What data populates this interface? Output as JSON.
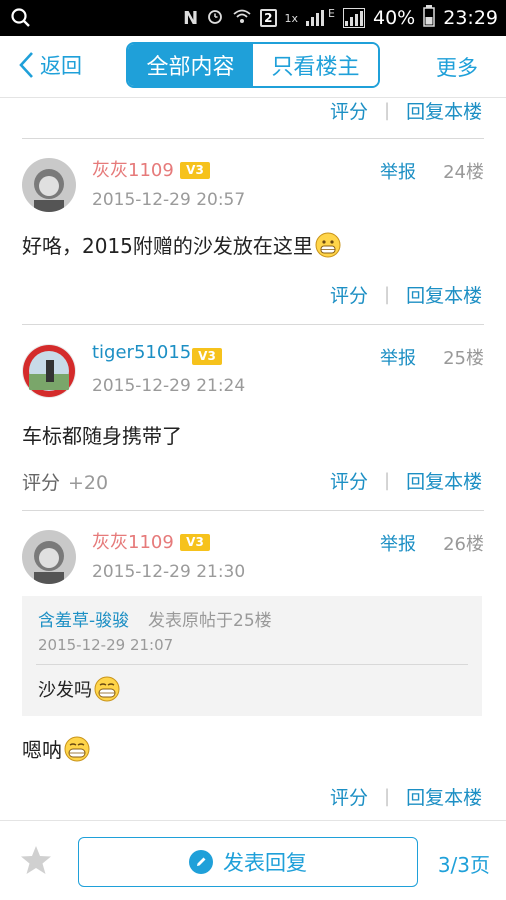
{
  "status_bar": {
    "battery": "40%",
    "time": "23:29",
    "network": "E",
    "net_speed": "1x",
    "notif_count": "2"
  },
  "nav": {
    "back_label": "返回",
    "tab_all": "全部内容",
    "tab_op": "只看楼主",
    "more_label": "更多"
  },
  "actions": {
    "rate": "评分",
    "reply": "回复本楼",
    "separator": "|"
  },
  "posts": [
    {
      "username": "灰灰1109",
      "level": "V3",
      "report": "举报",
      "floor": "24楼",
      "date": "2015-12-29 20:57",
      "text": "好咯，2015附赠的沙发放在这里",
      "emoji": "grin-emoji"
    },
    {
      "username": "tiger51015",
      "level": "V3",
      "report": "举报",
      "floor": "25楼",
      "date": "2015-12-29 21:24",
      "text": "车标都随身携带了",
      "rating_label": "评分",
      "rating_value": "+20"
    },
    {
      "username": "灰灰1109",
      "level": "V3",
      "report": "举报",
      "floor": "26楼",
      "date": "2015-12-29 21:30",
      "quote": {
        "author": "含羞草-骏骏",
        "note": "发表原帖于25楼",
        "date": "2015-12-29 21:07",
        "text": "沙发吗",
        "emoji": "grin-emoji"
      },
      "text": "嗯呐",
      "emoji": "grin-emoji"
    }
  ],
  "bottom": {
    "post_reply": "发表回复",
    "pages": "3/3页"
  },
  "colors": {
    "accent": "#1fa0d9",
    "username_pink": "#e67a7a",
    "level_badge": "#f6c21c"
  }
}
